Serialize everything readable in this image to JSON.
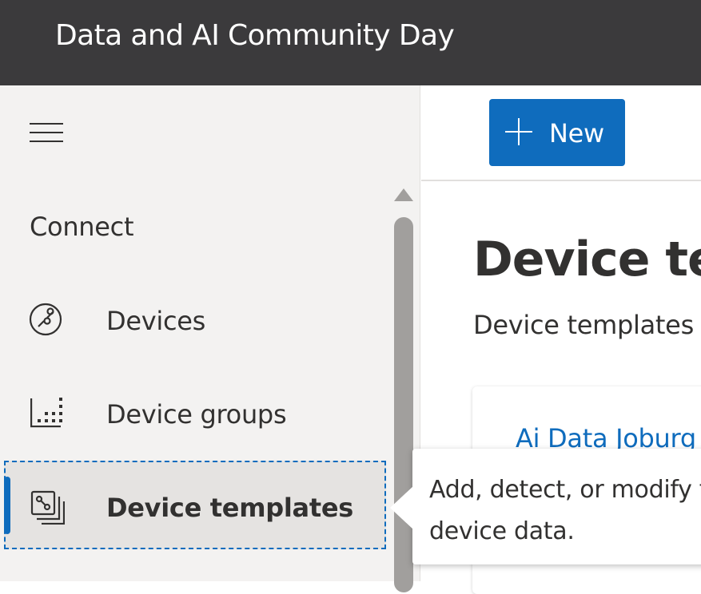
{
  "header": {
    "title": "Data and AI Community Day"
  },
  "sidebar": {
    "menu_icon": "hamburger-menu-icon",
    "section_label": "Connect",
    "items": [
      {
        "label": "Devices",
        "icon": "devices-icon",
        "active": false
      },
      {
        "label": "Device groups",
        "icon": "device-groups-icon",
        "active": false
      },
      {
        "label": "Device templates",
        "icon": "device-templates-icon",
        "active": true
      }
    ]
  },
  "toolbar": {
    "new_label": "New",
    "new_icon": "plus-icon"
  },
  "main": {
    "title": "Device te",
    "subtitle": "Device templates",
    "card_title": "Ai Data Joburg"
  },
  "tooltip": {
    "text": "Add, detect, or modify te device data."
  },
  "colors": {
    "topbar": "#3b3a3c",
    "accent": "#0f6cbd",
    "sidebar_bg": "#f3f2f1"
  }
}
